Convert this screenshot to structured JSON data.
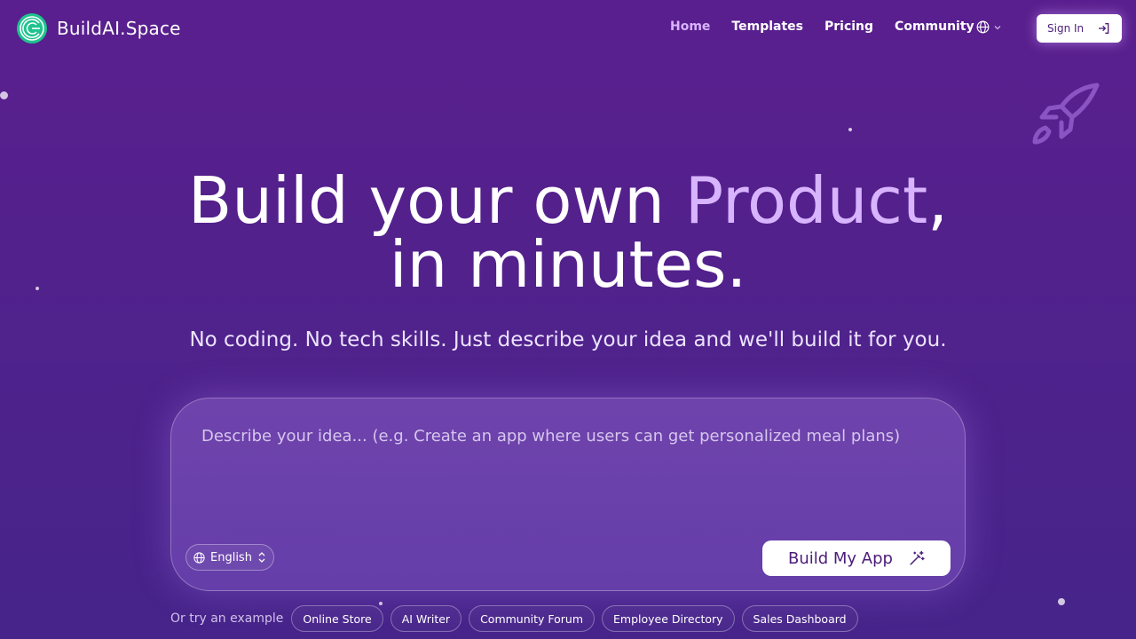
{
  "brand": {
    "name": "BuildAI.Space",
    "icon": "logo-icon",
    "accent": "#d8b4fe"
  },
  "nav": {
    "items": [
      {
        "label": "Home",
        "active": true
      },
      {
        "label": "Templates",
        "active": false
      },
      {
        "label": "Pricing",
        "active": false
      },
      {
        "label": "Community",
        "active": false
      }
    ],
    "language_icon": "globe-icon",
    "sign_in_label": "Sign In",
    "sign_in_icon": "sign-in-icon"
  },
  "hero": {
    "title_prefix": "Build your own ",
    "title_accent": "Product",
    "title_suffix": ",",
    "title_line2": "in minutes.",
    "subtitle": "No coding. No tech skills. Just describe your idea and we'll build it for you."
  },
  "prompt": {
    "placeholder": "Describe your idea... (e.g. Create an app where users can get personalized meal plans)",
    "value": "",
    "language": "English",
    "build_label": "Build My App",
    "build_icon": "magic-wand-icon"
  },
  "examples": {
    "label": "Or try an example",
    "items": [
      "Online Store",
      "AI Writer",
      "Community Forum",
      "Employee Directory",
      "Sales Dashboard"
    ]
  },
  "decor": {
    "rocket_icon": "rocket-icon"
  }
}
